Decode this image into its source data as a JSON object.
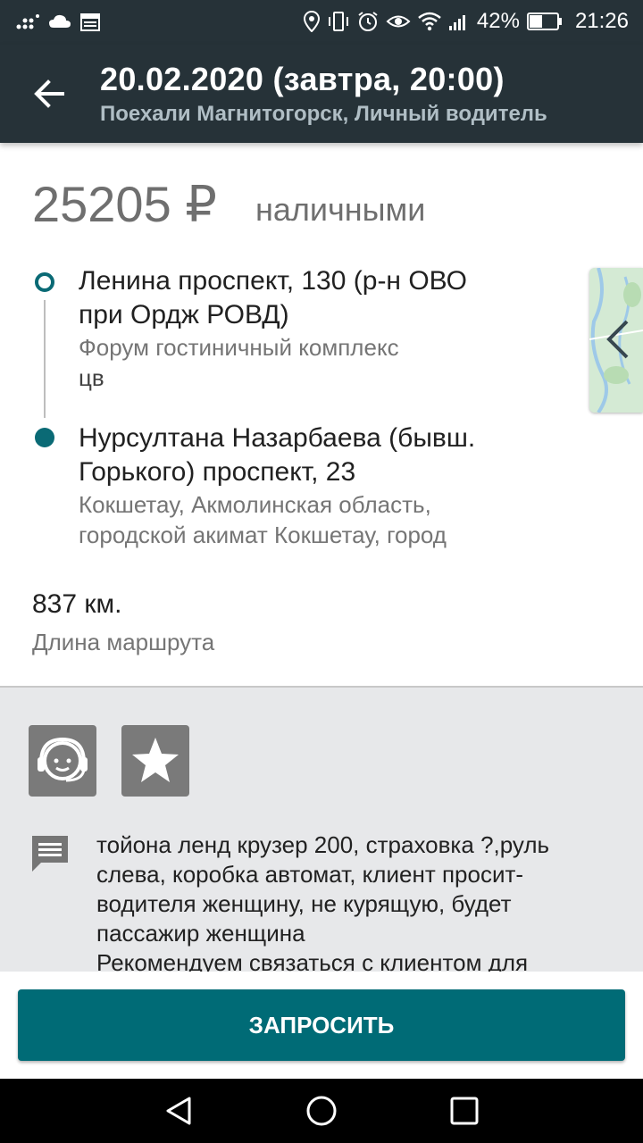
{
  "status_bar": {
    "battery": "42%",
    "time": "21:26",
    "left_icons": [
      "signal-dots-icon",
      "cloud-icon",
      "calendar-icon"
    ],
    "right_icons": [
      "location-icon",
      "vibrate-icon",
      "alarm-icon",
      "eye-icon",
      "wifi-icon",
      "cell-signal-icon",
      "battery-icon"
    ]
  },
  "header": {
    "title": "20.02.2020 (завтра, 20:00)",
    "subtitle": "Поехали Магнитогорск, Личный водитель"
  },
  "price": {
    "amount": "25205 ₽",
    "method": "наличными"
  },
  "route": {
    "from": {
      "main": "Ленина проспект, 130 (р-н ОВО при Ордж РОВД)",
      "detail": "Форум гостиничный комплекс",
      "detail2": "цв"
    },
    "to": {
      "main": "Нурсултана Назарбаева (бывш. Горького) проспект, 23",
      "detail": "Кокшетау, Акмолинская область, городской акимат Кокшетау, город"
    }
  },
  "distance": {
    "value": "837 км.",
    "label": "Длина маршрута"
  },
  "comment": {
    "text1": "тойона ленд крузер 200, страховка ?,руль слева, коробка автомат, клиент просит- водителя женщину, не курящую, будет пассажир женщина",
    "text2": "Рекомендуем связаться с клиентом для"
  },
  "action": {
    "request_label": "ЗАПРОСИТЬ"
  },
  "colors": {
    "app_bar": "#263238",
    "accent": "#006b76",
    "badge": "#7a7a7a",
    "section_bg": "#e7e8ea"
  }
}
